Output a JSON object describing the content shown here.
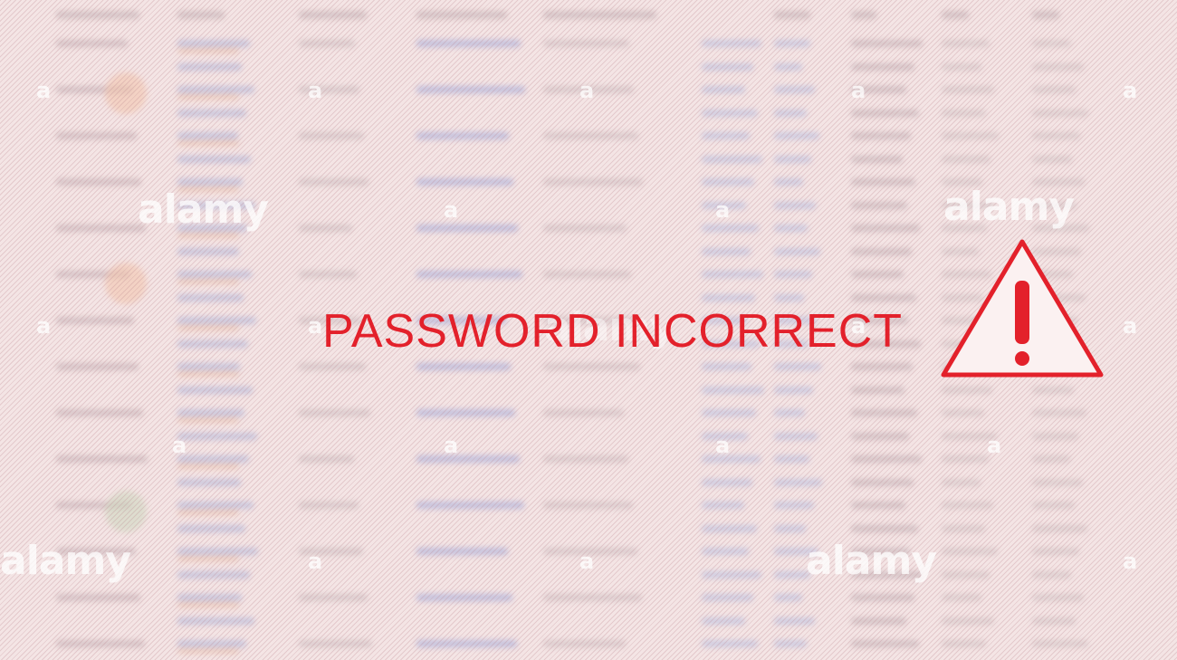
{
  "message": {
    "text": "PASSWORD INCORRECT",
    "color": "#e3212b"
  },
  "warning_icon": {
    "name": "warning-triangle-icon",
    "glyph": "!",
    "color": "#e3212b"
  },
  "watermark": {
    "brand": "alamy",
    "short": "a"
  },
  "colors": {
    "background": "#f3e3e3",
    "accent": "#e3212b"
  }
}
